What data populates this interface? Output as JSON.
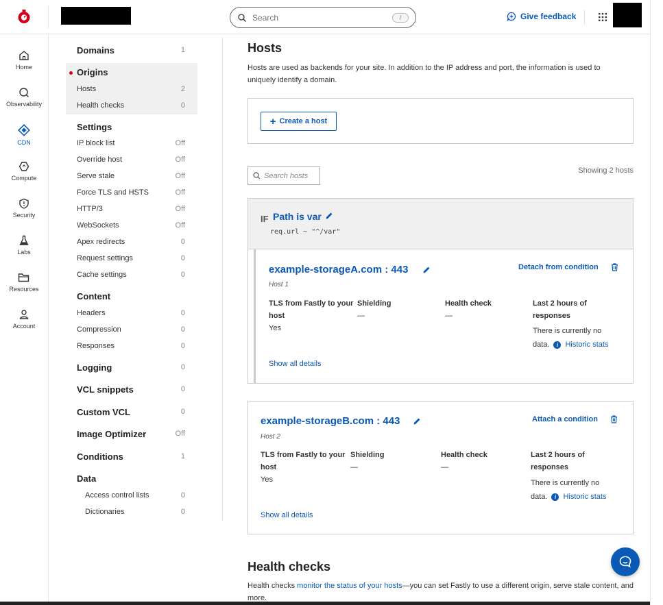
{
  "header": {
    "search_placeholder": "Search",
    "search_shortcut": "/",
    "feedback_label": "Give feedback"
  },
  "rail": [
    {
      "label": "Home",
      "icon": "home-icon"
    },
    {
      "label": "Observability",
      "icon": "magnifier-icon"
    },
    {
      "label": "CDN",
      "icon": "cdn-diamond-icon",
      "active": true
    },
    {
      "label": "Compute",
      "icon": "compute-icon"
    },
    {
      "label": "Security",
      "icon": "shield-icon"
    },
    {
      "label": "Labs",
      "icon": "flask-icon"
    },
    {
      "label": "Resources",
      "icon": "folder-icon"
    },
    {
      "label": "Account",
      "icon": "user-icon"
    }
  ],
  "nav": {
    "domains": {
      "label": "Domains",
      "value": "1"
    },
    "origins": {
      "label": "Origins"
    },
    "hosts": {
      "label": "Hosts",
      "value": "2"
    },
    "health_checks": {
      "label": "Health checks",
      "value": "0"
    },
    "settings": {
      "label": "Settings"
    },
    "settings_items": [
      {
        "label": "IP block list",
        "value": "Off"
      },
      {
        "label": "Override host",
        "value": "Off"
      },
      {
        "label": "Serve stale",
        "value": "Off"
      },
      {
        "label": "Force TLS and HSTS",
        "value": "Off"
      },
      {
        "label": "HTTP/3",
        "value": "Off"
      },
      {
        "label": "WebSockets",
        "value": "Off"
      },
      {
        "label": "Apex redirects",
        "value": "0"
      },
      {
        "label": "Request settings",
        "value": "0"
      },
      {
        "label": "Cache settings",
        "value": "0"
      }
    ],
    "content": {
      "label": "Content"
    },
    "content_items": [
      {
        "label": "Headers",
        "value": "0"
      },
      {
        "label": "Compression",
        "value": "0"
      },
      {
        "label": "Responses",
        "value": "0"
      }
    ],
    "logging": {
      "label": "Logging",
      "value": "0"
    },
    "vcl_snippets": {
      "label": "VCL snippets",
      "value": "0"
    },
    "custom_vcl": {
      "label": "Custom VCL",
      "value": "0"
    },
    "image_optimizer": {
      "label": "Image Optimizer",
      "value": "Off"
    },
    "conditions": {
      "label": "Conditions",
      "value": "1"
    },
    "data": {
      "label": "Data"
    },
    "data_items": [
      {
        "label": "Access control lists",
        "value": "0"
      },
      {
        "label": "Dictionaries",
        "value": "0"
      }
    ]
  },
  "main": {
    "title": "Hosts",
    "description": "Hosts are used as backends for your site. In addition to the IP address and port, the information is used to uniquely identify a domain.",
    "create_button": "Create a host",
    "search_placeholder": "Search hosts",
    "showing": "Showing 2 hosts",
    "condition": {
      "if_label": "IF",
      "name": "Path is var",
      "expression": "req.url ~ \"^/var\""
    },
    "hosts": [
      {
        "name": "example-storageA.com : 443",
        "sub": "Host 1",
        "action": "Detach from condition",
        "tls_header": "TLS from Fastly to your host",
        "tls_value": "Yes",
        "shielding_header": "Shielding",
        "shielding_value": "—",
        "health_header": "Health check",
        "health_value": "—",
        "last_header": "Last 2 hours of responses",
        "last_value_1": "There is currently no",
        "last_value_2": "data.",
        "historic": "Historic stats",
        "show_all": "Show all details"
      },
      {
        "name": "example-storageB.com : 443",
        "sub": "Host 2",
        "action": "Attach a condition",
        "tls_header": "TLS from Fastly to your host",
        "tls_value": "Yes",
        "shielding_header": "Shielding",
        "shielding_value": "—",
        "health_header": "Health check",
        "health_value": "—",
        "last_header": "Last 2 hours of responses",
        "last_value_1": "There is currently no",
        "last_value_2": "data.",
        "historic": "Historic stats",
        "show_all": "Show all details"
      }
    ],
    "health_checks": {
      "title": "Health checks",
      "desc_prefix": "Health checks ",
      "desc_link": "monitor the status of your hosts",
      "desc_suffix": "—you can set Fastly to use a different origin, serve stale content, and more."
    }
  },
  "colors": {
    "brand_blue": "#0a59b5",
    "logo_red": "#d0021b"
  }
}
